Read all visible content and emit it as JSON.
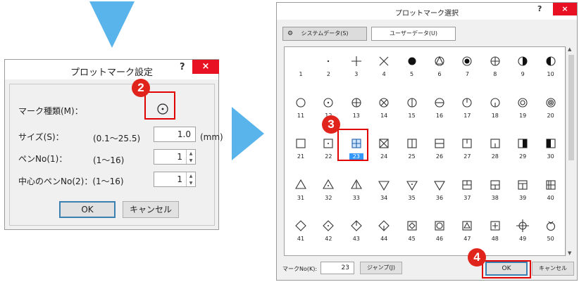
{
  "colors": {
    "accent": "#3399ff",
    "highlight": "#e00000",
    "arrow": "#5ab4ec",
    "close": "#e81123"
  },
  "step_badges": [
    "2",
    "3",
    "4"
  ],
  "dialog1": {
    "title": "プロットマーク設定",
    "help": "?",
    "close": "×",
    "mark_label": "マーク種類(M)：",
    "mark_icon": "dot-circle-icon",
    "size_label": "サイズ(S)：",
    "size_range": "(0.1～25.5)",
    "size_value": "1.0",
    "size_unit": "(mm)",
    "pen_label": "ペンNo(1)：",
    "pen_range": "(1～16)",
    "pen_value": "1",
    "center_pen_label": "中心のペンNo(2)：(1～16)",
    "center_pen_value": "1",
    "ok": "OK",
    "cancel": "キャンセル"
  },
  "dialog2": {
    "title": "プロットマーク選択",
    "help": "?",
    "close": "×",
    "tabs": [
      "システムデータ(S)",
      "ユーザーデータ(U)"
    ],
    "selected_mark": 23,
    "marks": [
      1,
      2,
      3,
      4,
      5,
      6,
      7,
      8,
      9,
      10,
      11,
      12,
      13,
      14,
      15,
      16,
      17,
      18,
      19,
      20,
      21,
      22,
      23,
      24,
      25,
      26,
      27,
      28,
      29,
      30,
      31,
      32,
      33,
      34,
      35,
      36,
      37,
      38,
      39,
      40,
      41,
      42,
      43,
      44,
      45,
      46,
      47,
      48,
      49,
      50
    ],
    "mark_no_label": "マークNo(K):",
    "mark_no_value": "23",
    "jump": "ジャンプ(J)",
    "ok": "OK",
    "cancel": "キャンセル"
  }
}
